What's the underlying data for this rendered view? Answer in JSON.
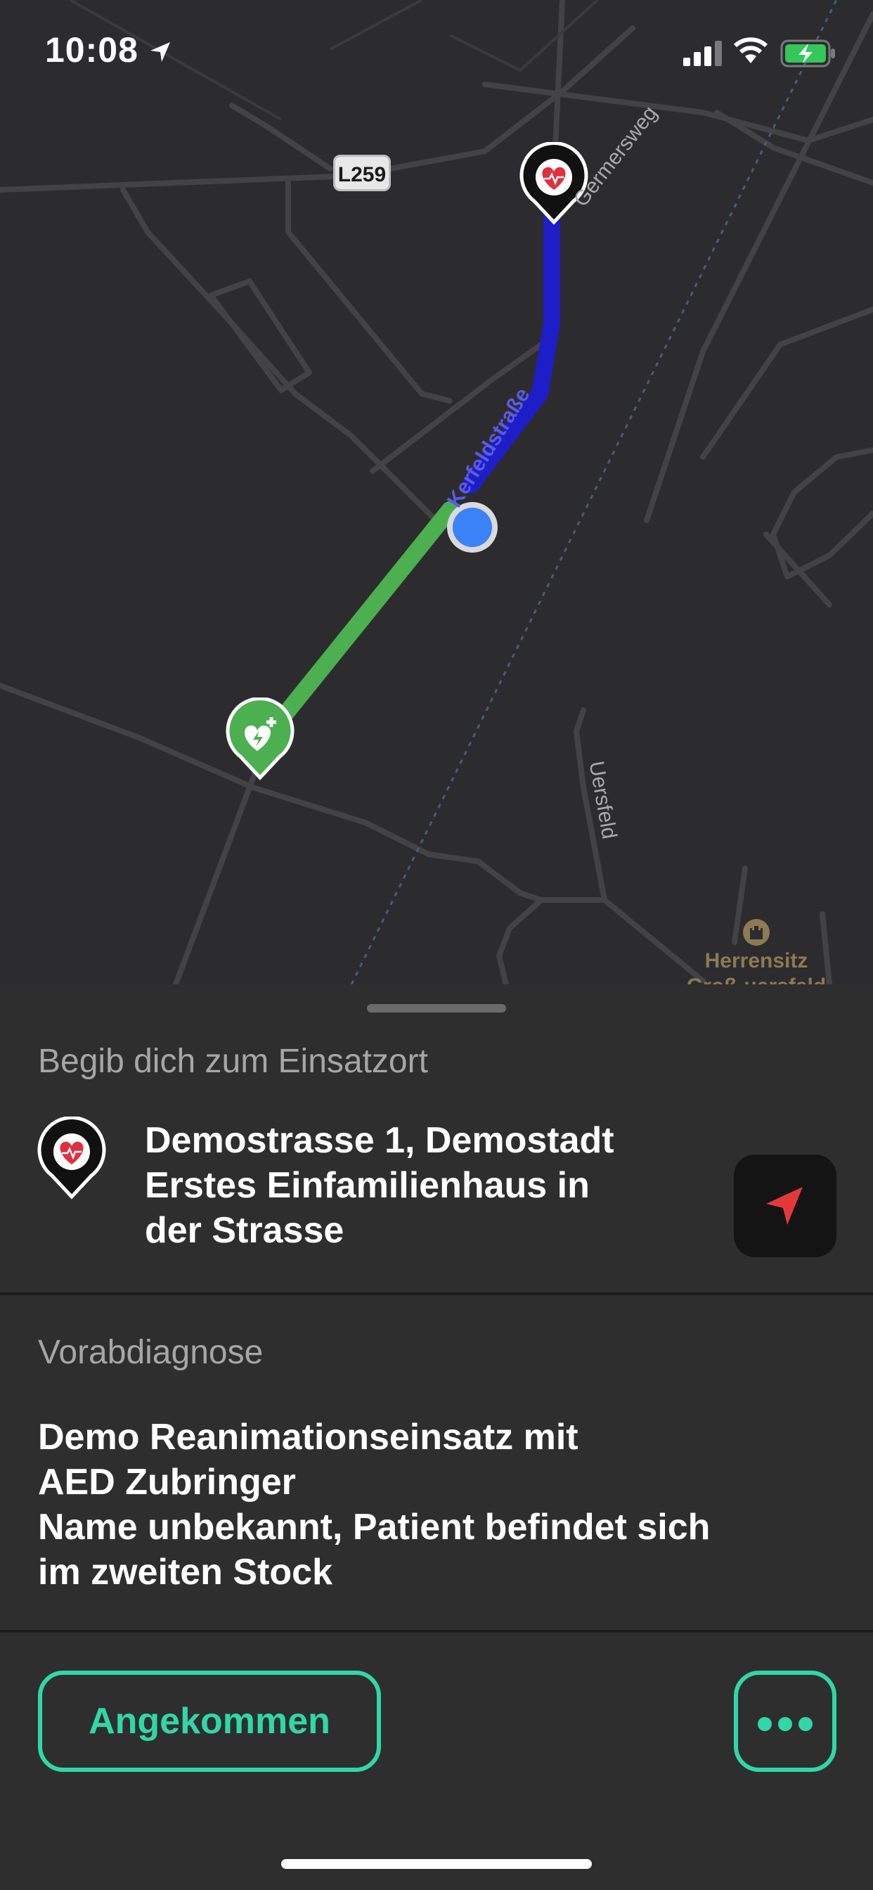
{
  "status_bar": {
    "time": "10:08"
  },
  "map": {
    "road_shield": "L259",
    "street_labels": [
      "Germersweg",
      "Uersfeld"
    ],
    "route_label": "Kerfeldstraße",
    "poi_label_line1": "Herrensitz",
    "poi_label_line2": "Groß-uersfeld",
    "route_colors": {
      "to_patient": "#1e1ec8",
      "aed_leg": "#4caf50"
    },
    "markers": [
      "patient-marker-icon",
      "aed-marker-icon",
      "current-location-icon"
    ]
  },
  "sheet": {
    "destination_heading": "Begib dich zum Einsatzort",
    "address": "Demostrasse 1, Demostadt\nErstes Einfamilienhaus in\nder Strasse",
    "diagnosis_heading": "Vorabdiagnose",
    "diagnosis_text": "Demo Reanimationseinsatz mit\nAED Zubringer\nName unbekannt, Patient befindet sich\nim zweiten Stock",
    "arrived_label": "Angekommen",
    "navigate_icon": "navigation-arrow-icon",
    "more_icon": "more-dots-icon",
    "accent_color": "#2fd8a6"
  }
}
